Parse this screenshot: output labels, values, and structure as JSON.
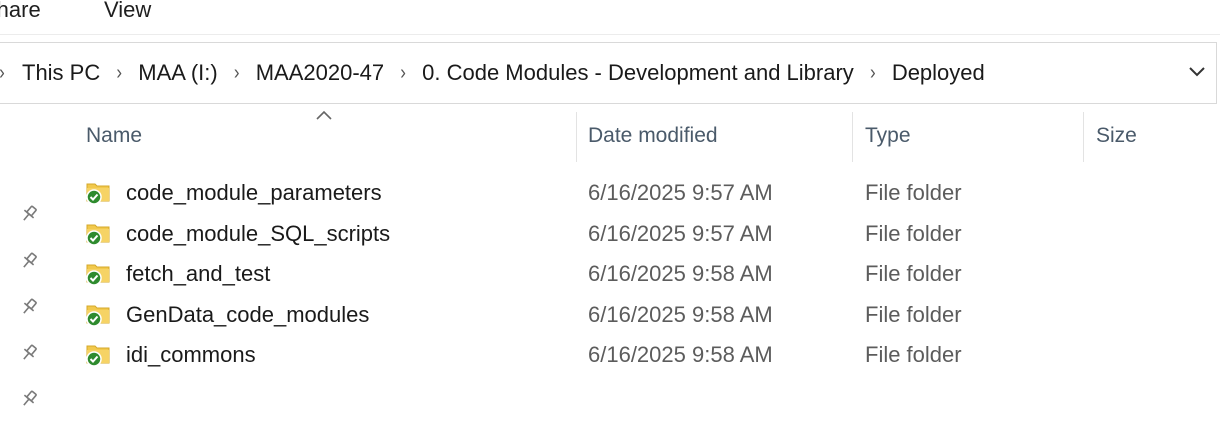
{
  "ribbon": {
    "tabs": [
      {
        "label": "Share"
      },
      {
        "label": "View"
      }
    ]
  },
  "address_bar": {
    "crumbs": [
      "This PC",
      "MAA (I:)",
      "MAA2020-47",
      "0. Code Modules - Development and Library",
      "Deployed"
    ]
  },
  "columns": {
    "name": "Name",
    "date_modified": "Date modified",
    "type": "Type",
    "size": "Size"
  },
  "files": [
    {
      "name": "code_module_parameters",
      "date": "6/16/2025 9:57 AM",
      "type": "File folder"
    },
    {
      "name": "code_module_SQL_scripts",
      "date": "6/16/2025 9:57 AM",
      "type": "File folder"
    },
    {
      "name": "fetch_and_test",
      "date": "6/16/2025 9:58 AM",
      "type": "File folder"
    },
    {
      "name": "GenData_code_modules",
      "date": "6/16/2025 9:58 AM",
      "type": "File folder"
    },
    {
      "name": "idi_commons",
      "date": "6/16/2025 9:58 AM",
      "type": "File folder"
    }
  ],
  "icons": {
    "folder": "folder-synced-icon",
    "pin": "pin-icon",
    "sort": "sort-ascending-icon",
    "dropdown": "chevron-down-icon"
  },
  "colors": {
    "folder_yellow": "#f2c94c",
    "sync_green": "#2e8b2e",
    "header_text": "#4a5a6a"
  }
}
